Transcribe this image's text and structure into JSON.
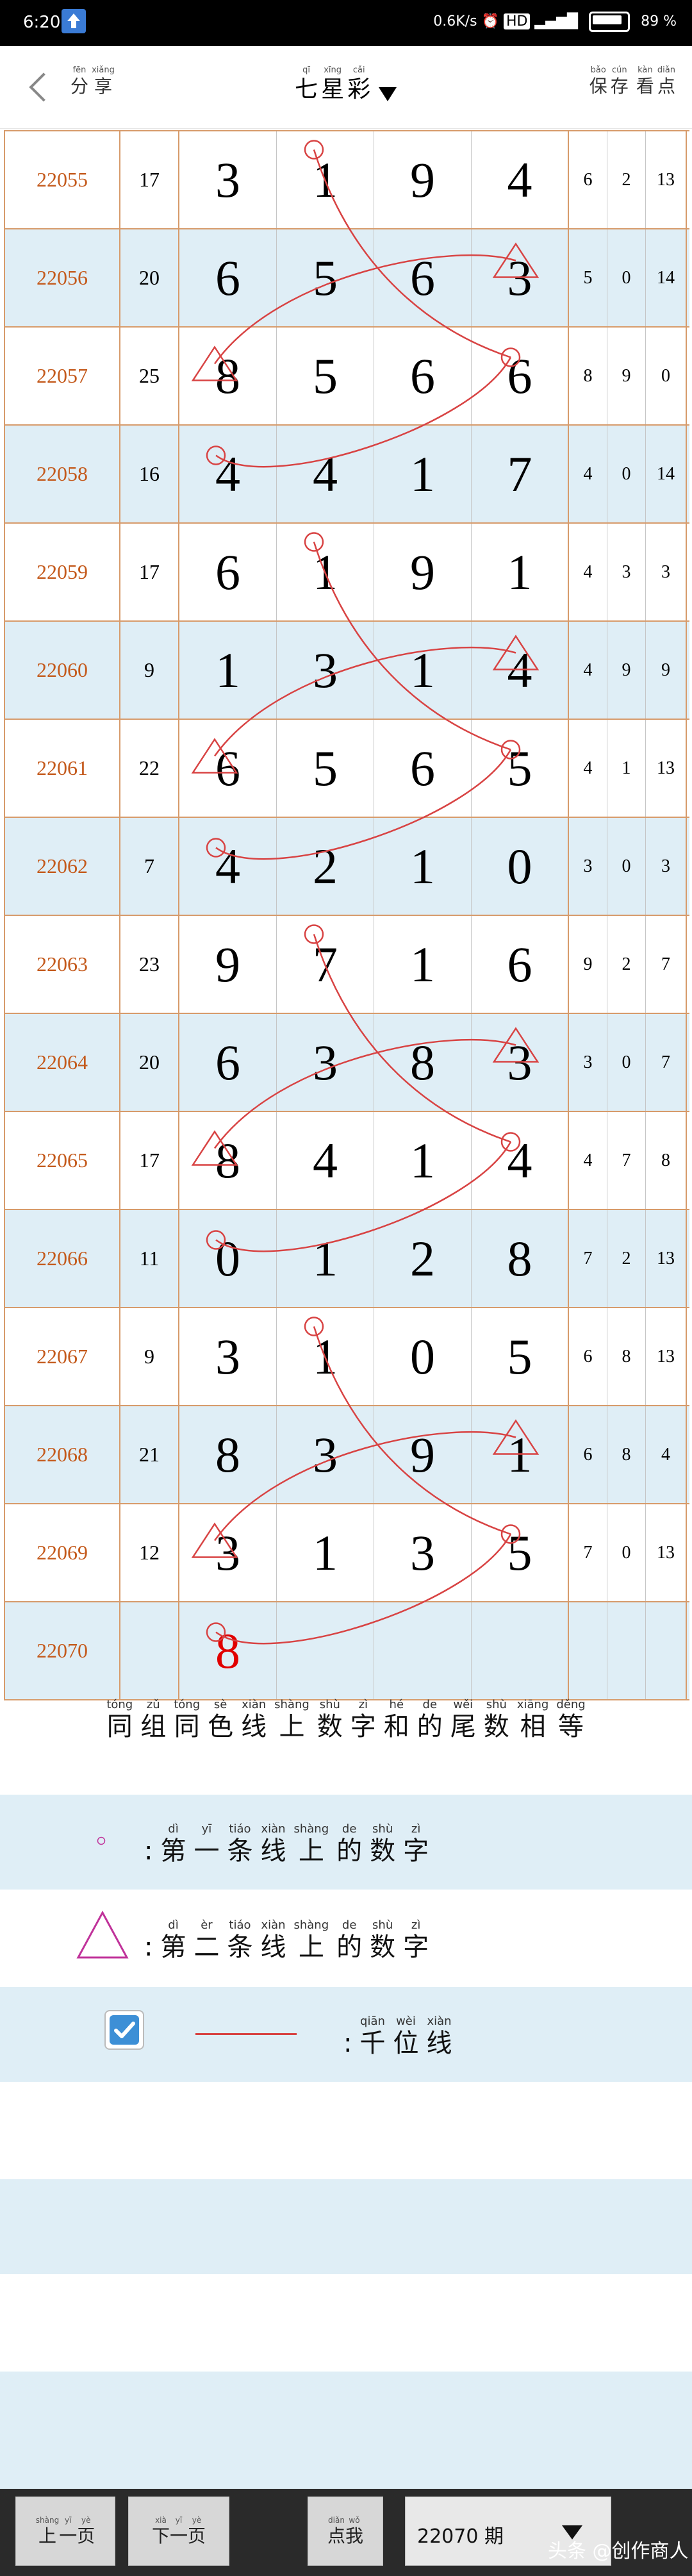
{
  "status_bar": {
    "time": "6:20",
    "speed": "0.6K/s",
    "hd_badge": "HD",
    "battery": "89 %"
  },
  "header": {
    "share": {
      "label": "分享",
      "pinyin": [
        "fēn",
        "xiǎng"
      ],
      "chars": [
        "分",
        "享"
      ]
    },
    "title": {
      "label": "七星彩",
      "pinyin": [
        "qī",
        "xīng",
        "cǎi"
      ],
      "chars": [
        "七",
        "星",
        "彩"
      ]
    },
    "actions": [
      {
        "label": "保存",
        "pinyin": [
          "bǎo",
          "cún"
        ],
        "chars": [
          "保",
          "存"
        ]
      },
      {
        "label": "看点",
        "pinyin": [
          "kàn",
          "diǎn"
        ],
        "chars": [
          "看",
          "点"
        ]
      }
    ]
  },
  "table": {
    "rows": [
      {
        "issue": "22055",
        "sum": "17",
        "digits": [
          "3",
          "1",
          "9",
          "4"
        ],
        "tails": [
          "6",
          "2",
          "13"
        ]
      },
      {
        "issue": "22056",
        "sum": "20",
        "digits": [
          "6",
          "5",
          "6",
          "3"
        ],
        "tails": [
          "5",
          "0",
          "14"
        ]
      },
      {
        "issue": "22057",
        "sum": "25",
        "digits": [
          "8",
          "5",
          "6",
          "6"
        ],
        "tails": [
          "8",
          "9",
          "0"
        ]
      },
      {
        "issue": "22058",
        "sum": "16",
        "digits": [
          "4",
          "4",
          "1",
          "7"
        ],
        "tails": [
          "4",
          "0",
          "14"
        ]
      },
      {
        "issue": "22059",
        "sum": "17",
        "digits": [
          "6",
          "1",
          "9",
          "1"
        ],
        "tails": [
          "4",
          "3",
          "3"
        ]
      },
      {
        "issue": "22060",
        "sum": "9",
        "digits": [
          "1",
          "3",
          "1",
          "4"
        ],
        "tails": [
          "4",
          "9",
          "9"
        ]
      },
      {
        "issue": "22061",
        "sum": "22",
        "digits": [
          "6",
          "5",
          "6",
          "5"
        ],
        "tails": [
          "4",
          "1",
          "13"
        ]
      },
      {
        "issue": "22062",
        "sum": "7",
        "digits": [
          "4",
          "2",
          "1",
          "0"
        ],
        "tails": [
          "3",
          "0",
          "3"
        ]
      },
      {
        "issue": "22063",
        "sum": "23",
        "digits": [
          "9",
          "7",
          "1",
          "6"
        ],
        "tails": [
          "9",
          "2",
          "7"
        ]
      },
      {
        "issue": "22064",
        "sum": "20",
        "digits": [
          "6",
          "3",
          "8",
          "3"
        ],
        "tails": [
          "3",
          "0",
          "7"
        ]
      },
      {
        "issue": "22065",
        "sum": "17",
        "digits": [
          "8",
          "4",
          "1",
          "4"
        ],
        "tails": [
          "4",
          "7",
          "8"
        ]
      },
      {
        "issue": "22066",
        "sum": "11",
        "digits": [
          "0",
          "1",
          "2",
          "8"
        ],
        "tails": [
          "7",
          "2",
          "13"
        ]
      },
      {
        "issue": "22067",
        "sum": "9",
        "digits": [
          "3",
          "1",
          "0",
          "5"
        ],
        "tails": [
          "6",
          "8",
          "13"
        ]
      },
      {
        "issue": "22068",
        "sum": "21",
        "digits": [
          "8",
          "3",
          "9",
          "1"
        ],
        "tails": [
          "6",
          "8",
          "4"
        ]
      },
      {
        "issue": "22069",
        "sum": "12",
        "digits": [
          "3",
          "1",
          "3",
          "5"
        ],
        "tails": [
          "7",
          "0",
          "13"
        ]
      },
      {
        "issue": "22070",
        "sum": "",
        "digits": [
          "8",
          "",
          "",
          ""
        ],
        "tails": [
          "",
          "",
          ""
        ]
      }
    ]
  },
  "legend": {
    "title": {
      "label": "同组同色线上数字和的尾数相等",
      "chars": [
        "同",
        "组",
        "同",
        "色",
        "线",
        "上",
        "数",
        "字",
        "和",
        "的",
        "尾",
        "数",
        "相",
        "等"
      ],
      "pinyin": [
        "tóng",
        "zǔ",
        "tóng",
        "sè",
        "xiàn",
        "shàng",
        "shù",
        "zì",
        "hé",
        "de",
        "wěi",
        "shù",
        "xiāng",
        "děng"
      ]
    },
    "items": [
      {
        "marker": "circle",
        "colon": ":",
        "label": "第一条线上的数字",
        "chars": [
          "第",
          "一",
          "条",
          "线",
          "上",
          "的",
          "数",
          "字"
        ],
        "pinyin": [
          "dì",
          "yī",
          "tiáo",
          "xiàn",
          "shàng",
          "de",
          "shù",
          "zì"
        ]
      },
      {
        "marker": "triangle",
        "colon": ":",
        "label": "第二条线上的数字",
        "chars": [
          "第",
          "二",
          "条",
          "线",
          "上",
          "的",
          "数",
          "字"
        ],
        "pinyin": [
          "dì",
          "èr",
          "tiáo",
          "xiàn",
          "shàng",
          "de",
          "shù",
          "zì"
        ]
      },
      {
        "marker": "line",
        "checked": true,
        "colon": ":",
        "label": "千位线",
        "chars": [
          "千",
          "位",
          "线"
        ],
        "pinyin": [
          "qiān",
          "wèi",
          "xiàn"
        ]
      }
    ]
  },
  "bottom_bar": {
    "prev": {
      "label": "上一页",
      "chars": [
        "上",
        "一",
        "页"
      ],
      "pinyin": [
        "shàng",
        "yī",
        "yè"
      ]
    },
    "next": {
      "label": "下一页",
      "chars": [
        "下",
        "一",
        "页"
      ],
      "pinyin": [
        "xià",
        "yī",
        "yè"
      ]
    },
    "click": {
      "label": "点我",
      "chars": [
        "点",
        "我"
      ],
      "pinyin": [
        "diǎn",
        "wǒ"
      ]
    },
    "period_select": {
      "value": "22070 期"
    }
  },
  "watermark": "头条 @创作商人",
  "colors": {
    "accent_line": "#d84343",
    "issue_text": "#c45a1c",
    "grid_border": "#d79b6b",
    "row_alt": "#dfeef6",
    "new_digit": "#e10000",
    "triangle_marker": "#c0329a"
  }
}
